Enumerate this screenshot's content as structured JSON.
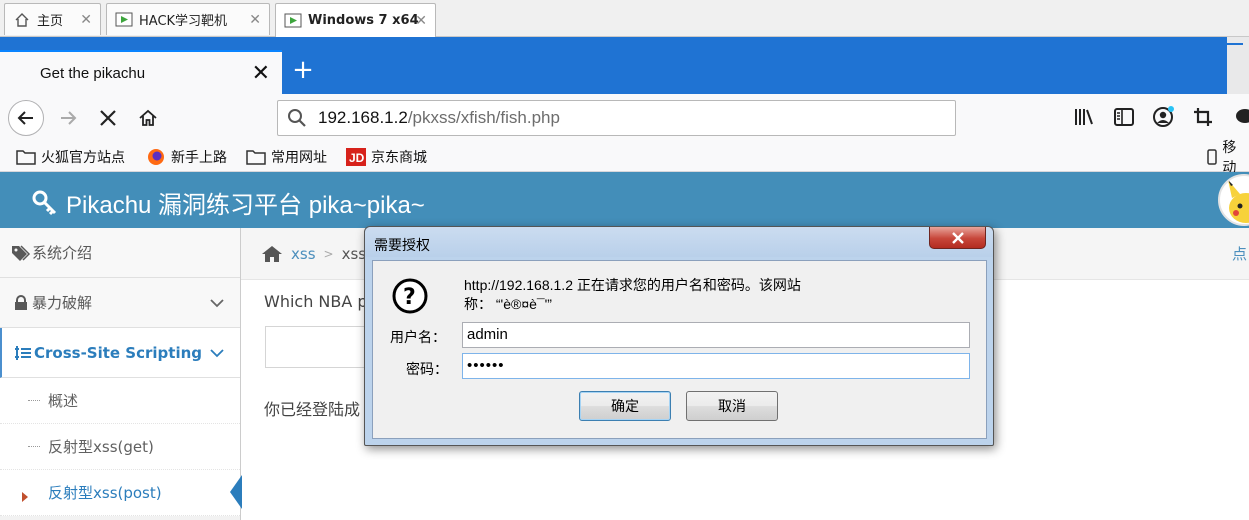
{
  "vm_tabs": [
    {
      "label": "主页",
      "icon": "home-icon"
    },
    {
      "label": "HACK学习靶机",
      "icon": "vm-icon"
    },
    {
      "label": "Windows 7 x64",
      "icon": "vm-icon",
      "active": true
    }
  ],
  "browser": {
    "tab_title": "Get the pikachu",
    "url_host": "192.168.1.2",
    "url_path": "/pkxss/xfish/fish.php",
    "bookmarks": [
      {
        "label": "火狐官方站点",
        "icon": "folder-icon"
      },
      {
        "label": "新手上路",
        "icon": "firefox-icon"
      },
      {
        "label": "常用网址",
        "icon": "folder-icon"
      },
      {
        "label": "京东商城",
        "icon": "jd-icon"
      }
    ],
    "mobile_bookmark": "移动"
  },
  "page": {
    "brand": "Pikachu 漏洞练习平台 pika~pika~",
    "sidebar": [
      {
        "label": "系统介绍",
        "icon": "tags-icon"
      },
      {
        "label": "暴力破解",
        "icon": "lock-icon"
      },
      {
        "label": "Cross-Site Scripting",
        "icon": "list-icon",
        "open": true
      }
    ],
    "submenu": [
      {
        "label": "概述"
      },
      {
        "label": "反射型xss(get)"
      },
      {
        "label": "反射型xss(post)",
        "active": true
      }
    ],
    "breadcrumb": [
      "xss",
      "xss"
    ],
    "breadcrumb_tip": "点",
    "question": "Which NBA p",
    "logged_msg": "你已经登陆成"
  },
  "auth_dialog": {
    "title": "需要授权",
    "message_line1": "http://192.168.1.2 正在请求您的用户名和密码。该网站",
    "message_line2": "称： “'è®¤è¯'”",
    "username_label": "用户名：",
    "username_value": "admin",
    "password_label": "密码：",
    "password_value": "••••••",
    "ok_label": "确定",
    "cancel_label": "取消"
  }
}
